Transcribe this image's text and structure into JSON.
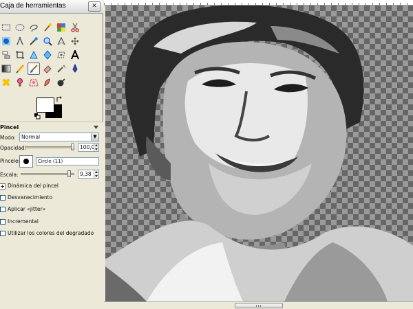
{
  "toolbox": {
    "title": "Caja de herramientas",
    "tools": [
      {
        "name": "rect-select-icon"
      },
      {
        "name": "ellipse-select-icon"
      },
      {
        "name": "free-select-icon"
      },
      {
        "name": "fuzzy-select-icon"
      },
      {
        "name": "color-select-icon"
      },
      {
        "name": "scissors-select-icon"
      },
      {
        "name": "foreground-select-icon"
      },
      {
        "name": "paths-icon"
      },
      {
        "name": "color-picker-icon"
      },
      {
        "name": "zoom-icon"
      },
      {
        "name": "measure-icon"
      },
      {
        "name": "move-icon"
      },
      {
        "name": "align-icon"
      },
      {
        "name": "crop-icon"
      },
      {
        "name": "rotate-icon"
      },
      {
        "name": "scale-icon"
      },
      {
        "name": "shear-icon"
      },
      {
        "name": "text-icon"
      },
      {
        "name": "bucket-fill-icon"
      },
      {
        "name": "blend-icon"
      },
      {
        "name": "pencil-icon"
      },
      {
        "name": "paintbrush-icon",
        "active": true
      },
      {
        "name": "eraser-icon"
      },
      {
        "name": "airbrush-icon"
      },
      {
        "name": "heal-icon"
      },
      {
        "name": "clone-icon"
      },
      {
        "name": "perspective-clone-icon"
      },
      {
        "name": "smudge-icon"
      },
      {
        "name": "dodge-burn-icon"
      }
    ],
    "colors": {
      "foreground": "#ffffff",
      "background": "#000000"
    }
  },
  "tool_options": {
    "title": "Pincel",
    "mode_label": "Modo:",
    "mode_value": "Normal",
    "opacity_label": "Opacidad:",
    "opacity_value": "100,0",
    "opacity_fraction": 1.0,
    "brush_label": "Pinceles:",
    "brush_value": "Circle (11)",
    "scale_label": "Escala:",
    "scale_value": "9,38",
    "scale_fraction": 0.94,
    "options": [
      {
        "label": "Dinámica del pincel",
        "expander": true
      },
      {
        "label": "Desvanecimiento",
        "checked": false
      },
      {
        "label": "Aplicar «jitter»",
        "checked": false
      },
      {
        "label": "Incremental",
        "checked": false
      },
      {
        "label": "Utilizar los colores del degradado",
        "checked": false
      }
    ]
  }
}
